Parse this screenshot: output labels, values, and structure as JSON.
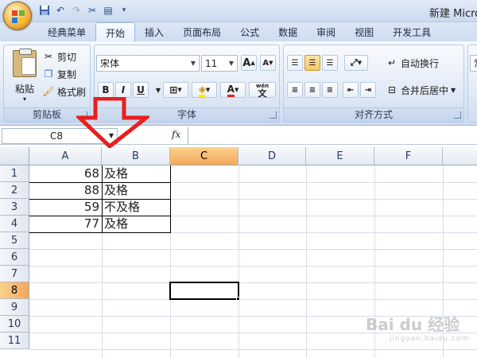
{
  "window": {
    "title": "新建 Micro"
  },
  "quick_access": {
    "icons": [
      "save-icon",
      "undo-icon",
      "redo-icon",
      "paint-icon",
      "format-icon"
    ]
  },
  "tabs": [
    {
      "label": "经典菜单"
    },
    {
      "label": "开始"
    },
    {
      "label": "插入"
    },
    {
      "label": "页面布局"
    },
    {
      "label": "公式"
    },
    {
      "label": "数据"
    },
    {
      "label": "审阅"
    },
    {
      "label": "视图"
    },
    {
      "label": "开发工具"
    }
  ],
  "ribbon": {
    "clipboard": {
      "group_label": "剪贴板",
      "paste_label": "粘贴",
      "cut_label": "剪切",
      "copy_label": "复制",
      "format_painter_label": "格式刷"
    },
    "font": {
      "group_label": "字体",
      "font_name": "宋体",
      "font_size": "11",
      "bold": "B",
      "italic": "I",
      "underline": "U",
      "grow": "A",
      "shrink": "A",
      "phonetic": "wén",
      "phonetic_char": "文"
    },
    "alignment": {
      "group_label": "对齐方式",
      "wrap_label": "自动换行",
      "merge_label": "合并后居中"
    },
    "number": {
      "partial_label": "常"
    }
  },
  "formula_bar": {
    "name_box": "C8",
    "fx": "fx",
    "value": ""
  },
  "sheet": {
    "columns": [
      "A",
      "B",
      "C",
      "D",
      "E",
      "F"
    ],
    "rows": [
      "1",
      "2",
      "3",
      "4",
      "5",
      "6",
      "7",
      "8",
      "9",
      "10",
      "11"
    ],
    "selected_column": "C",
    "selected_row": "8",
    "data": [
      {
        "a": "68",
        "b": "及格"
      },
      {
        "a": "88",
        "b": "及格"
      },
      {
        "a": "59",
        "b": "不及格"
      },
      {
        "a": "77",
        "b": "及格"
      }
    ]
  },
  "watermark": {
    "text": "Bai du 经验",
    "sub": "jingyan.baidu.com"
  },
  "colors": {
    "arrow": "#e81e1e",
    "selection_header": "#f4a65a"
  }
}
